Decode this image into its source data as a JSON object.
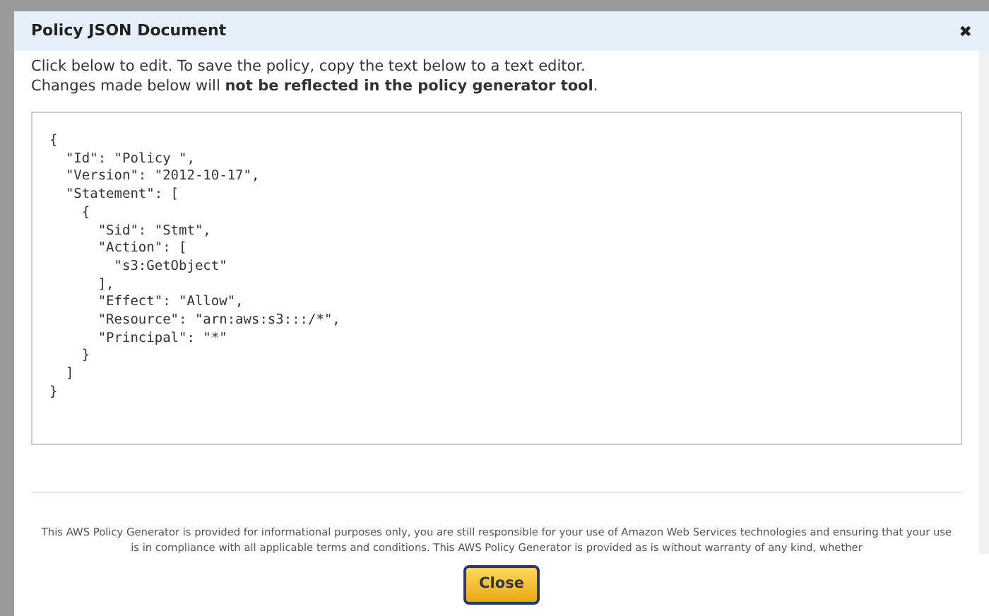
{
  "dialog": {
    "title": "Policy JSON Document",
    "close_icon": "✖",
    "intro": [
      "Click below to edit. To save the policy, copy the text below to a text editor.",
      "Changes made below will **not be reflected in the policy generator tool**."
    ],
    "policy_text": "{\n  \"Id\": \"Policy \",\n  \"Version\": \"2012-10-17\",\n  \"Statement\": [\n    {\n      \"Sid\": \"Stmt\",\n      \"Action\": [\n        \"s3:GetObject\"\n      ],\n      \"Effect\": \"Allow\",\n      \"Resource\": \"arn:aws:s3:::/*\",\n      \"Principal\": \"*\"\n    }\n  ]\n}",
    "disclaimer": "This AWS Policy Generator is provided for informational purposes only, you are still responsible for your use of Amazon Web Services technologies and ensuring that your use is in compliance with all applicable terms and conditions. This AWS Policy Generator is provided as is without warranty of any kind, whether",
    "button": "Close"
  }
}
